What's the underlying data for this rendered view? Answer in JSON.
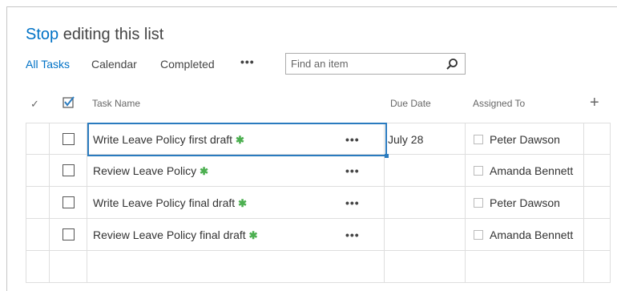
{
  "title": {
    "stop": "Stop",
    "rest": " editing this list"
  },
  "views": {
    "all_tasks": "All Tasks",
    "calendar": "Calendar",
    "completed": "Completed",
    "more": "•••"
  },
  "search": {
    "placeholder": "Find an item",
    "icon": "search-icon"
  },
  "columns": {
    "check": "✓",
    "task_name": "Task Name",
    "due_date": "Due Date",
    "assigned_to": "Assigned To",
    "add": "+"
  },
  "rows": [
    {
      "task": "Write Leave Policy first draft",
      "new_marker": "✱",
      "due": "July 28",
      "assigned": "Peter Dawson"
    },
    {
      "task": "Review Leave Policy",
      "new_marker": "✱",
      "due": "",
      "assigned": "Amanda Bennett"
    },
    {
      "task": "Write Leave Policy final draft",
      "new_marker": "✱",
      "due": "",
      "assigned": "Peter Dawson"
    },
    {
      "task": "Review Leave Policy final draft",
      "new_marker": "✱",
      "due": "",
      "assigned": "Amanda Bennett"
    }
  ],
  "row_menu": "•••",
  "colors": {
    "accent": "#0072c6",
    "selection": "#2a7bbf",
    "new_marker": "#4caf50"
  }
}
